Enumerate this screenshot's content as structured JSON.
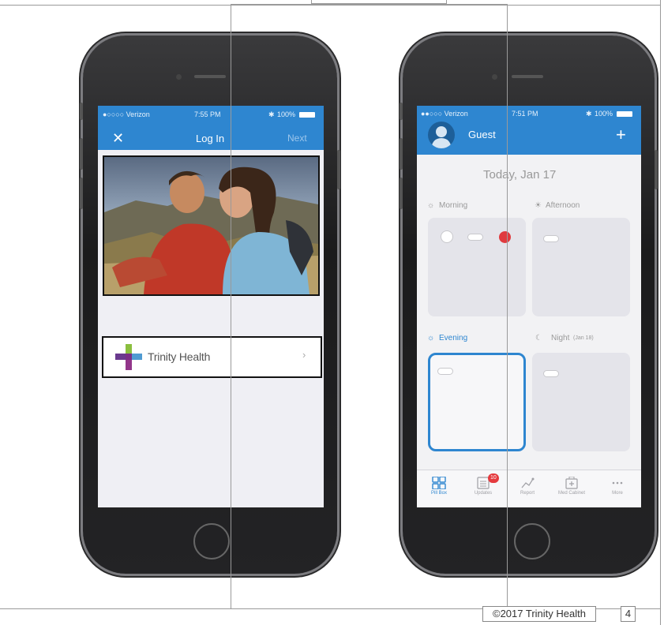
{
  "footer": {
    "copyright": "©2017 Trinity Health",
    "page_number": "4"
  },
  "login_phone": {
    "status_bar": {
      "carrier": "●○○○○ Verizon",
      "time": "7:55 PM",
      "battery": "100%"
    },
    "nav": {
      "close_icon": "close-icon",
      "title": "Log In",
      "next_label": "Next"
    },
    "provider": {
      "name": "Trinity Health",
      "chevron": "›"
    }
  },
  "pillbox_phone": {
    "status_bar": {
      "carrier": "●●○○○ Verizon",
      "time": "7:51 PM",
      "battery": "100%"
    },
    "header": {
      "user_name": "Guest",
      "add_label": "+"
    },
    "date_title": "Today, Jan 17",
    "slots": {
      "morning": "Morning",
      "afternoon": "Afternoon",
      "evening": "Evening",
      "night": "Night",
      "night_note": "(Jan 18)"
    },
    "tabs": [
      {
        "label": "Pill Box",
        "icon": "grid-icon"
      },
      {
        "label": "Updates",
        "icon": "updates-icon",
        "badge": "10"
      },
      {
        "label": "Report",
        "icon": "chart-icon"
      },
      {
        "label": "Med Cabinet",
        "icon": "cabinet-icon"
      },
      {
        "label": "More",
        "icon": "more-icon"
      }
    ],
    "colors": {
      "accent": "#2e86d0",
      "alert": "#e03a3e"
    }
  }
}
